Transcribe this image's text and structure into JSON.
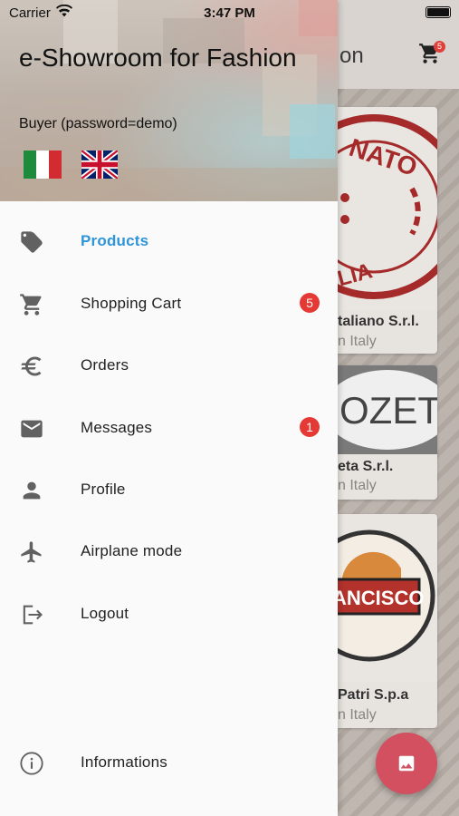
{
  "status_bar": {
    "carrier": "Carrier",
    "time": "3:47 PM"
  },
  "background": {
    "appbar_title_fragment": "on",
    "cart_badge": "5",
    "cards": [
      {
        "name": "taliano S.r.l.",
        "sub": "n Italy",
        "logo_text": "NATO LIA"
      },
      {
        "name": "eta S.r.l.",
        "sub": "n Italy",
        "logo_text": "OZETA"
      },
      {
        "name": "Patri  S.p.a",
        "sub": "n Italy",
        "logo_text": "ANCISCO"
      }
    ]
  },
  "drawer": {
    "title": "e-Showroom for Fashion",
    "subtitle": "Buyer (password=demo)",
    "languages": [
      {
        "code": "it",
        "icon": "italy-flag-icon"
      },
      {
        "code": "en",
        "icon": "uk-flag-icon"
      }
    ],
    "items": [
      {
        "label": "Products",
        "icon": "tags-icon",
        "active": true
      },
      {
        "label": "Shopping Cart",
        "icon": "cart-icon",
        "badge": "5"
      },
      {
        "label": "Orders",
        "icon": "euro-icon"
      },
      {
        "label": "Messages",
        "icon": "mail-icon",
        "badge": "1"
      },
      {
        "label": "Profile",
        "icon": "person-icon"
      },
      {
        "label": "Airplane mode",
        "icon": "airplane-icon"
      },
      {
        "label": "Logout",
        "icon": "logout-icon"
      }
    ],
    "footer_item": {
      "label": "Informations",
      "icon": "info-icon"
    }
  },
  "colors": {
    "active": "#2e95d8",
    "badge": "#e53935",
    "icon": "#616161",
    "fab": "#d2505f"
  }
}
